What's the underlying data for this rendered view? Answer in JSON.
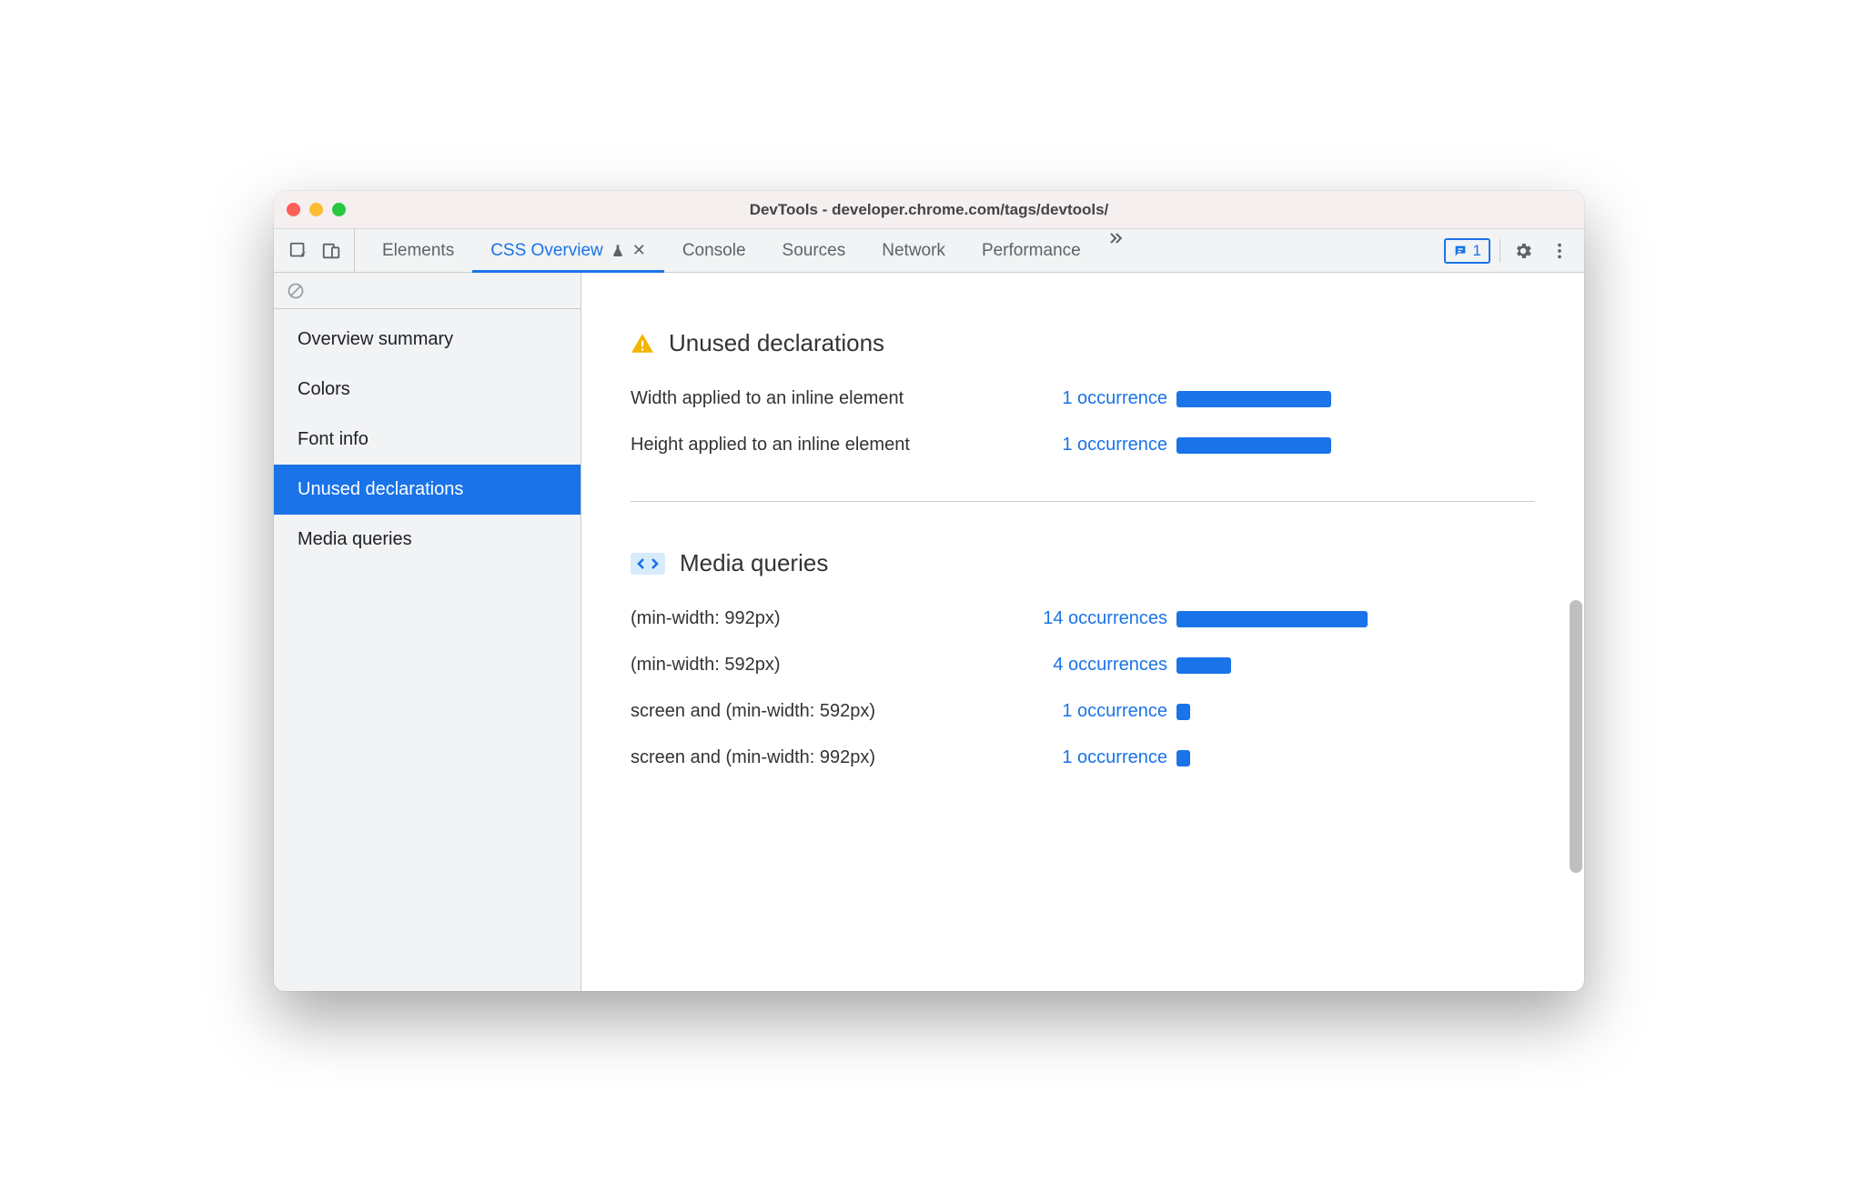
{
  "window": {
    "title": "DevTools - developer.chrome.com/tags/devtools/"
  },
  "toolbar": {
    "tabs": [
      {
        "label": "Elements",
        "active": false
      },
      {
        "label": "CSS Overview",
        "active": true,
        "closable": true,
        "experimental": true
      },
      {
        "label": "Console",
        "active": false
      },
      {
        "label": "Sources",
        "active": false
      },
      {
        "label": "Network",
        "active": false
      },
      {
        "label": "Performance",
        "active": false
      }
    ],
    "issues_count": "1"
  },
  "sidebar": {
    "items": [
      {
        "label": "Overview summary"
      },
      {
        "label": "Colors"
      },
      {
        "label": "Font info"
      },
      {
        "label": "Unused declarations",
        "selected": true
      },
      {
        "label": "Media queries"
      }
    ]
  },
  "sections": {
    "unused": {
      "title": "Unused declarations",
      "rows": [
        {
          "label": "Width applied to an inline element",
          "count": "1 occurrence",
          "bar": 170
        },
        {
          "label": "Height applied to an inline element",
          "count": "1 occurrence",
          "bar": 170
        }
      ]
    },
    "media": {
      "title": "Media queries",
      "rows": [
        {
          "label": "(min-width: 992px)",
          "count": "14 occurrences",
          "bar": 210
        },
        {
          "label": "(min-width: 592px)",
          "count": "4 occurrences",
          "bar": 60
        },
        {
          "label": "screen and (min-width: 592px)",
          "count": "1 occurrence",
          "bar": 15
        },
        {
          "label": "screen and (min-width: 992px)",
          "count": "1 occurrence",
          "bar": 15
        }
      ]
    }
  }
}
